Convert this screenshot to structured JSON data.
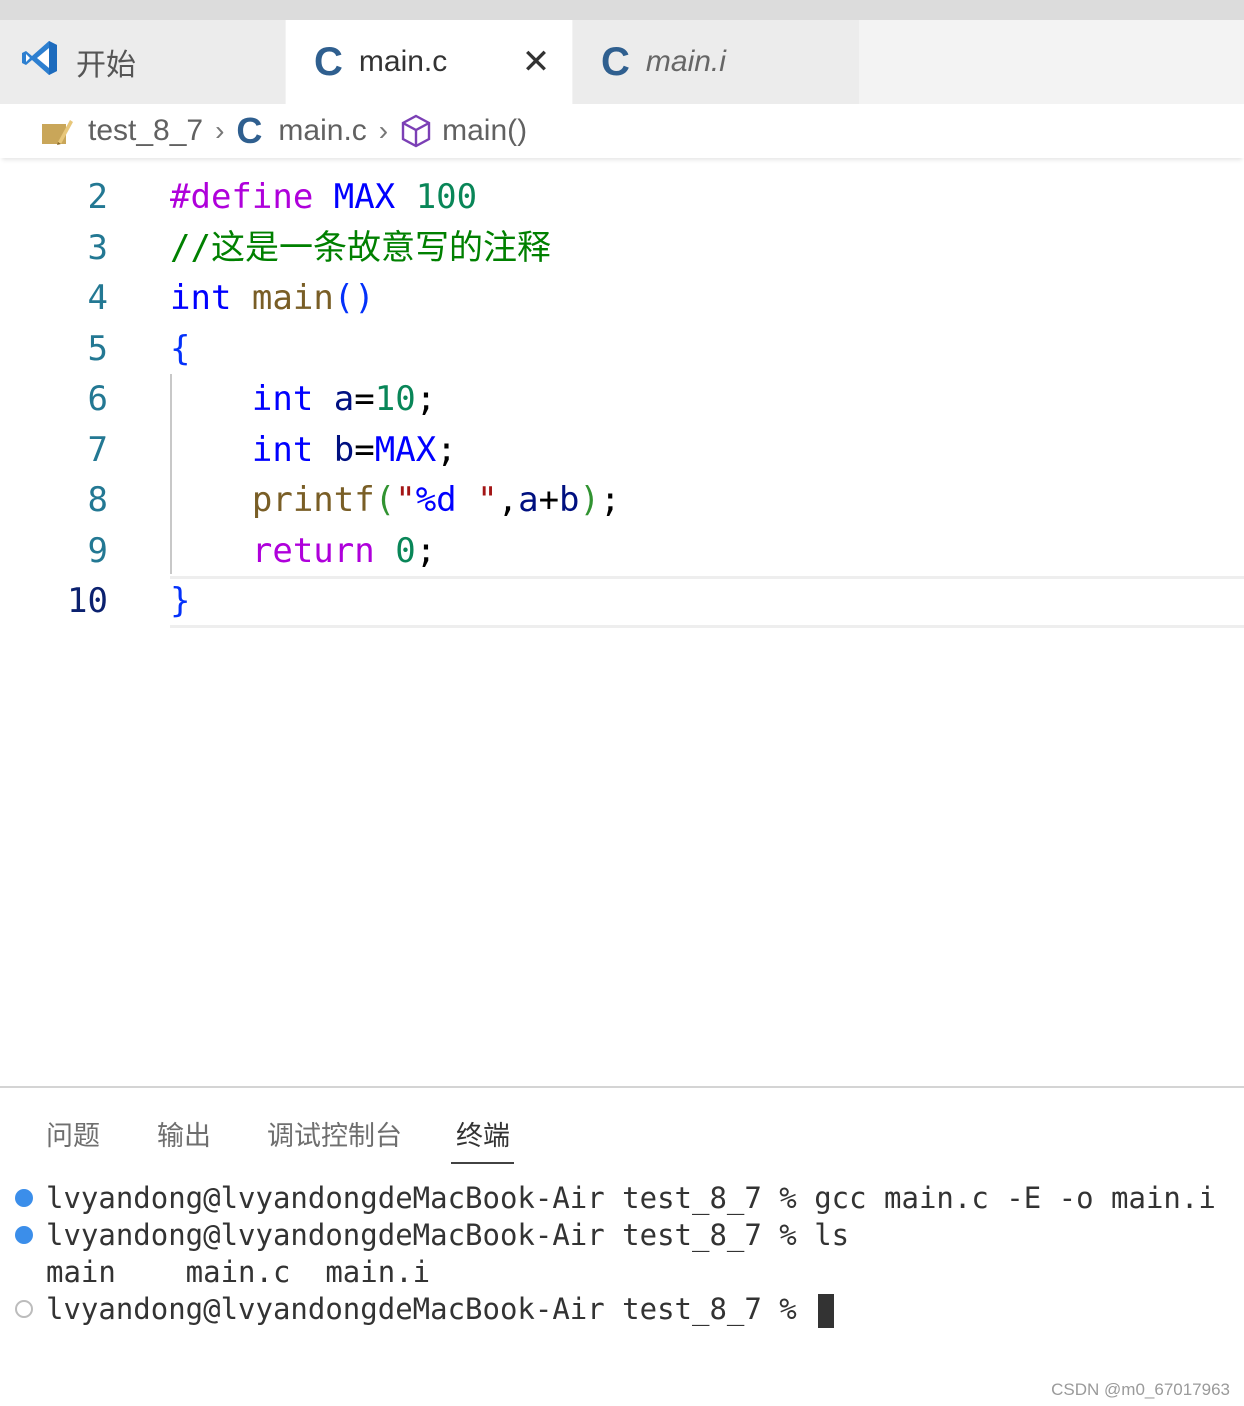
{
  "tabs": [
    {
      "label": "开始",
      "icon": "vscode-logo-icon"
    },
    {
      "label": "main.c",
      "icon": "c-file-icon",
      "active": true,
      "closable": true
    },
    {
      "label": "main.i",
      "icon": "c-file-icon",
      "italic": true
    }
  ],
  "tab_c_glyph": "C",
  "close_glyph": "✕",
  "breadcrumb": {
    "folder": "test_8_7",
    "file": "main.c",
    "symbol": "main()",
    "separator": "›"
  },
  "editor": {
    "active_line": 10,
    "lines": [
      {
        "num": "2",
        "tokens": [
          [
            "#define",
            "macro"
          ],
          [
            " ",
            "plain"
          ],
          [
            "MAX",
            "name"
          ],
          [
            " ",
            "plain"
          ],
          [
            "100",
            "num"
          ]
        ]
      },
      {
        "num": "3",
        "tokens": [
          [
            "//这是一条故意写的注释",
            "comment"
          ]
        ]
      },
      {
        "num": "4",
        "tokens": [
          [
            "int",
            "type"
          ],
          [
            " ",
            "plain"
          ],
          [
            "main",
            "func"
          ],
          [
            "()",
            "brace"
          ]
        ]
      },
      {
        "num": "5",
        "tokens": [
          [
            "{",
            "brace"
          ]
        ]
      },
      {
        "num": "6",
        "tokens": [
          [
            "    ",
            "plain"
          ],
          [
            "int",
            "type"
          ],
          [
            " ",
            "plain"
          ],
          [
            "a",
            "var"
          ],
          [
            "=",
            "plain"
          ],
          [
            "10",
            "num"
          ],
          [
            ";",
            "plain"
          ]
        ]
      },
      {
        "num": "7",
        "tokens": [
          [
            "    ",
            "plain"
          ],
          [
            "int",
            "type"
          ],
          [
            " ",
            "plain"
          ],
          [
            "b",
            "var"
          ],
          [
            "=",
            "plain"
          ],
          [
            "MAX",
            "name"
          ],
          [
            ";",
            "plain"
          ]
        ]
      },
      {
        "num": "8",
        "tokens": [
          [
            "    ",
            "plain"
          ],
          [
            "printf",
            "func"
          ],
          [
            "(",
            "paren2"
          ],
          [
            "\"",
            "string"
          ],
          [
            "%d",
            "name"
          ],
          [
            " \"",
            "string"
          ],
          [
            ",",
            "plain"
          ],
          [
            "a",
            "var"
          ],
          [
            "+",
            "plain"
          ],
          [
            "b",
            "var"
          ],
          [
            ")",
            "paren2"
          ],
          [
            ";",
            "plain"
          ]
        ]
      },
      {
        "num": "9",
        "tokens": [
          [
            "    ",
            "plain"
          ],
          [
            "return",
            "control"
          ],
          [
            " ",
            "plain"
          ],
          [
            "0",
            "num"
          ],
          [
            ";",
            "plain"
          ]
        ]
      },
      {
        "num": "10",
        "tokens": [
          [
            "}",
            "brace"
          ]
        ]
      }
    ]
  },
  "panel": {
    "tabs": [
      "问题",
      "输出",
      "调试控制台",
      "终端"
    ],
    "active_tab": "终端"
  },
  "terminal": {
    "lines": [
      {
        "text": "lvyandong@lvyandongdeMacBook-Air test_8_7 % gcc main.c -E -o main.i",
        "marker": "filled"
      },
      {
        "text": "lvyandong@lvyandongdeMacBook-Air test_8_7 % ls",
        "marker": "filled"
      },
      {
        "text": "main    main.c  main.i",
        "marker": "none"
      },
      {
        "text": "lvyandong@lvyandongdeMacBook-Air test_8_7 % ",
        "marker": "hollow",
        "cursor": true
      }
    ]
  },
  "watermark": "CSDN @m0_67017963",
  "colors": {
    "terminal_dot": "#3b8eea",
    "line_number": "#237893",
    "c_icon": "#2f5f8f"
  }
}
